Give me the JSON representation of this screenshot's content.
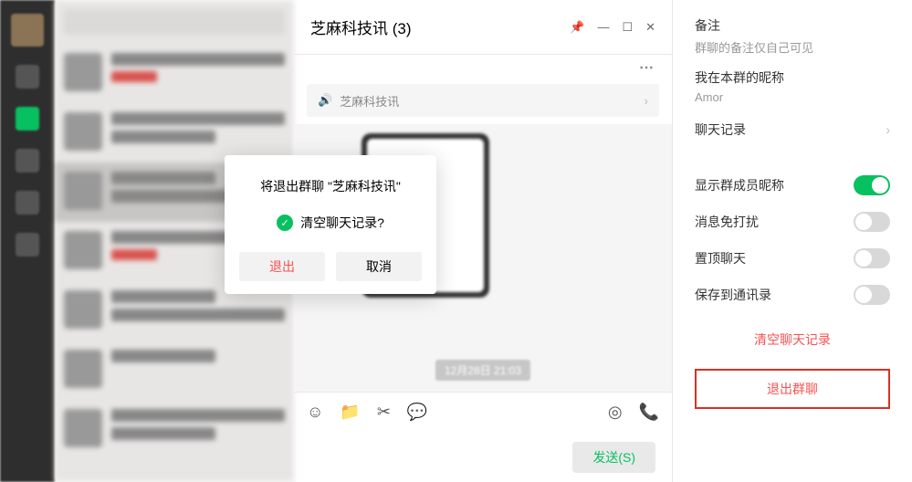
{
  "chat": {
    "title": "芝麻科技讯 (3)",
    "notice": "芝麻科技讯",
    "timestamp": "12月28日 21:03",
    "send_label": "发送(S)"
  },
  "panel": {
    "remark_label": "备注",
    "remark_hint": "群聊的备注仅自己可见",
    "nick_label": "我在本群的昵称",
    "nick_value": "Amor",
    "history_label": "聊天记录",
    "toggles": {
      "show_nick": "显示群成员昵称",
      "mute": "消息免打扰",
      "pin": "置顶聊天",
      "save": "保存到通讯录"
    },
    "clear_label": "清空聊天记录",
    "leave_label": "退出群聊"
  },
  "dialog": {
    "title": "将退出群聊 \"芝麻科技讯\"",
    "check_label": "清空聊天记录?",
    "leave": "退出",
    "cancel": "取消"
  }
}
